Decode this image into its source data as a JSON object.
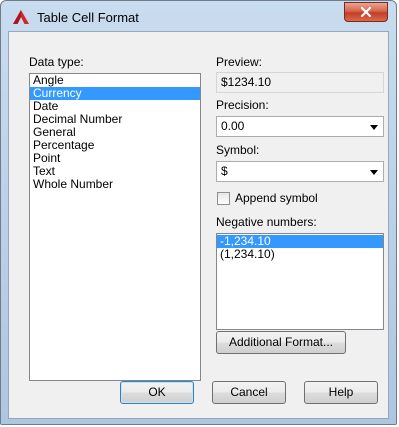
{
  "window": {
    "title": "Table Cell Format"
  },
  "data_type": {
    "label": "Data type:",
    "items": [
      "Angle",
      "Currency",
      "Date",
      "Decimal Number",
      "General",
      "Percentage",
      "Point",
      "Text",
      "Whole Number"
    ],
    "selected": "Currency"
  },
  "preview": {
    "label": "Preview:",
    "value": "$1234.10"
  },
  "precision": {
    "label": "Precision:",
    "value": "0.00"
  },
  "symbol": {
    "label": "Symbol:",
    "value": "$"
  },
  "append_symbol": {
    "label": "Append symbol",
    "checked": false
  },
  "negative_numbers": {
    "label": "Negative numbers:",
    "items": [
      "-1,234.10",
      "(1,234.10)"
    ],
    "selected": "-1,234.10"
  },
  "buttons": {
    "additional_format": "Additional Format...",
    "ok": "OK",
    "cancel": "Cancel",
    "help": "Help"
  },
  "colors": {
    "selection": "#3399ff",
    "close_button": "#c8472f",
    "app_icon": "#d0262c"
  },
  "icons": {
    "app": "autocad-a-icon",
    "close": "close-icon",
    "dropdown": "chevron-down-icon"
  }
}
